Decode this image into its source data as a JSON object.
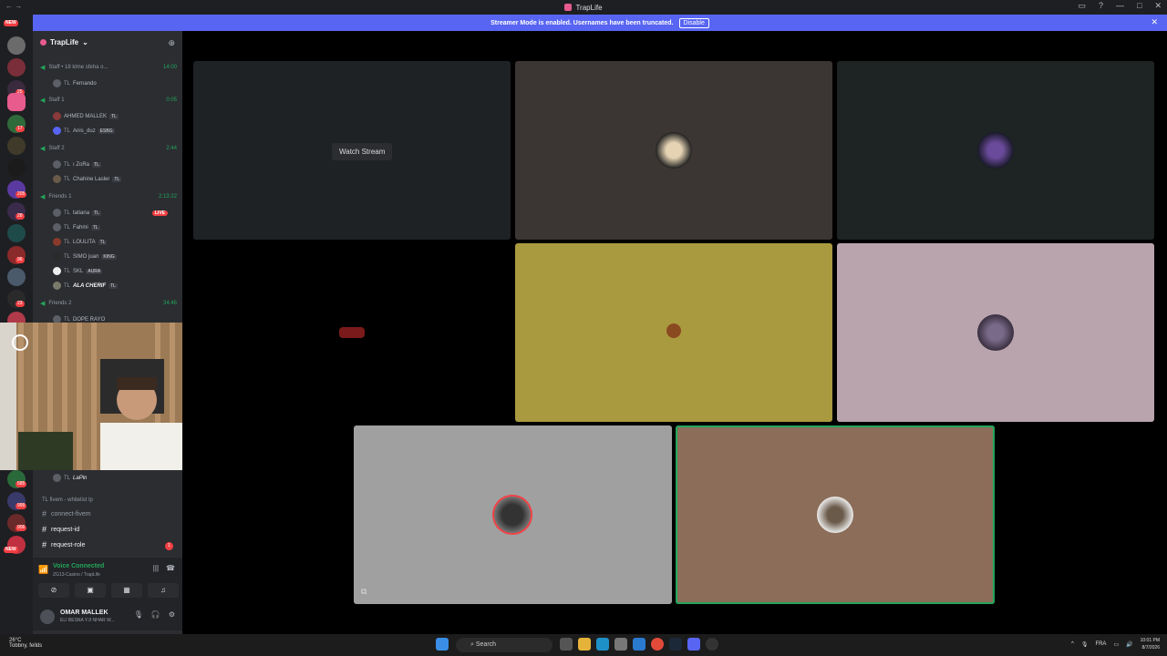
{
  "window": {
    "title": "TrapLife"
  },
  "banner": {
    "text": "Streamer Mode is enabled. Usernames have been truncated.",
    "disable_label": "Disable"
  },
  "server": {
    "name": "TrapLife"
  },
  "channels": {
    "voice": [
      {
        "name": "Staff • 18 klme sfeha o...",
        "time": "14:00"
      },
      {
        "name": "Staff 1",
        "time": "0:05"
      },
      {
        "name": "Staff 2",
        "time": "2:44"
      },
      {
        "name": "Friends 1",
        "time": "2:13:22"
      },
      {
        "name": "Friends 2",
        "time": "34:46"
      }
    ],
    "users": [
      {
        "prefix": "TL",
        "name": "Fernando"
      },
      {
        "prefix": "",
        "name": "AHMED MALLEK"
      },
      {
        "prefix": "TL",
        "name": "Anis_duz"
      },
      {
        "prefix": "TL",
        "name": "ı ZoRa"
      },
      {
        "prefix": "TL",
        "name": "Chahine Lasler"
      },
      {
        "prefix": "TL",
        "name": "tatiana"
      },
      {
        "prefix": "TL",
        "name": "Fahmi"
      },
      {
        "prefix": "TL",
        "name": "LOULITA"
      },
      {
        "prefix": "TL",
        "name": "SIMO juan"
      },
      {
        "prefix": "TL",
        "name": "SKL"
      },
      {
        "prefix": "TL",
        "name": "ALA CHERIF"
      },
      {
        "prefix": "TL",
        "name": "DOPE RAYO"
      },
      {
        "prefix": "TL",
        "name": "LaPin"
      }
    ],
    "tags": {
      "tl": "TL",
      "esbg": "ESBG",
      "king": "KING",
      "aura": "AURA",
      "live": "LIVE"
    },
    "category": "TL fivem - whitelist lp",
    "text": [
      {
        "name": "connect-fivem"
      },
      {
        "name": "request-id"
      },
      {
        "name": "request-role",
        "badge": "1"
      }
    ]
  },
  "voice_status": {
    "title": "Voice Connected",
    "channel": "ZG13-Casino / TrapLife"
  },
  "user_panel": {
    "name": "OMAR MALLEK",
    "status": "ELI BESNA YJI NHAR W..."
  },
  "stage": {
    "watch_label": "Watch Stream"
  },
  "server_badges": {
    "new_top": "NEW",
    "new_bottom": "NEW",
    "b1": "25",
    "b2": "17",
    "b3": "205",
    "b4": "28",
    "b5": "96",
    "b6": "23",
    "b7": "585",
    "b8": "999",
    "b9": "906"
  },
  "taskbar": {
    "weather_temp": "26°C",
    "weather_desc": "Tobbny, fellds",
    "search_label": "Search",
    "lang": "FRA",
    "time": "10:01 PM",
    "date": "8/7/2026"
  },
  "colors": {
    "accent": "#5865f2",
    "voice_green": "#23a55a",
    "live_red": "#f23f43"
  }
}
